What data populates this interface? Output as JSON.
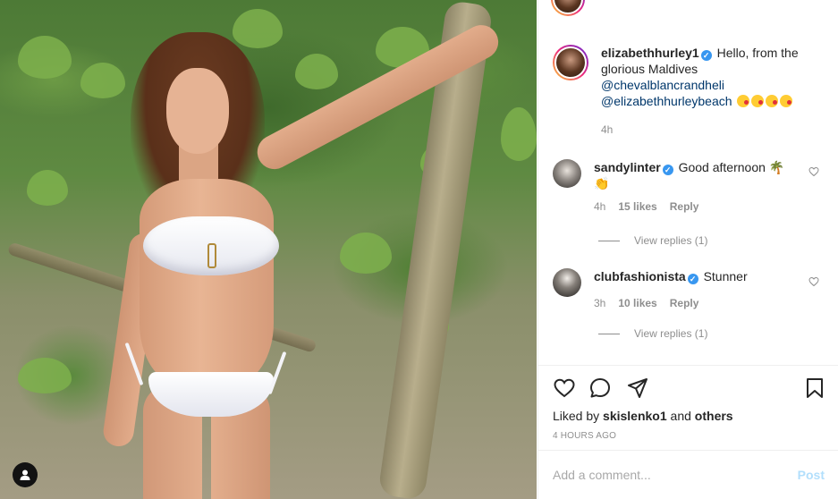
{
  "post": {
    "author": "elizabethhurley1",
    "caption_text": "Hello, from the glorious Maldives",
    "mention_1": "@chevalblancrandheli",
    "mention_2": "@elizabethhurleybeach",
    "caption_time": "4h"
  },
  "comments": [
    {
      "username": "sandylinter",
      "text": "Good afternoon",
      "time": "4h",
      "likes": "15 likes",
      "reply_label": "Reply",
      "view_replies": "View replies (1)"
    },
    {
      "username": "clubfashionista",
      "text": "Stunner",
      "time": "3h",
      "likes": "10 likes",
      "reply_label": "Reply",
      "view_replies": "View replies (1)"
    }
  ],
  "likes_bar": {
    "prefix": "Liked by",
    "user": "skislenko1",
    "middle": "and",
    "suffix": "others"
  },
  "timestamp": "4 HOURS AGO",
  "add_comment": {
    "placeholder": "Add a comment...",
    "post_label": "Post"
  },
  "colors": {
    "verified": "#3897f0",
    "link": "#00376b",
    "muted": "#8e8e8e",
    "post_disabled": "#b2dffc"
  },
  "icons": [
    "heart-icon",
    "comment-icon",
    "share-icon",
    "bookmark-icon",
    "user-tag-icon",
    "verified-icon"
  ]
}
